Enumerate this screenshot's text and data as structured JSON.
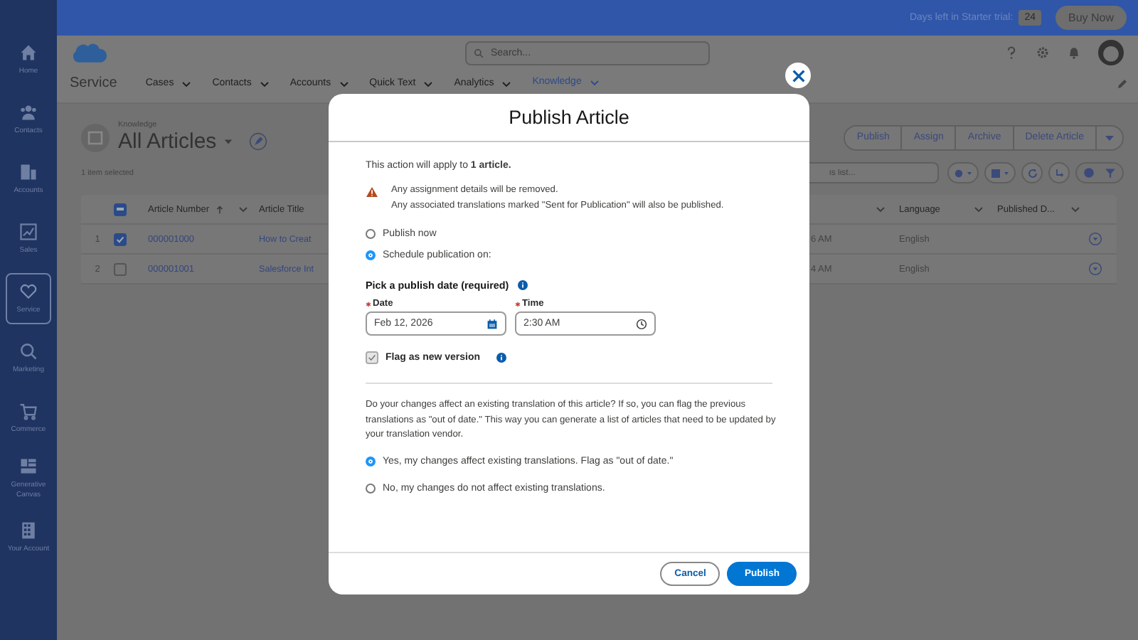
{
  "sidebar": {
    "items": [
      {
        "label": "Home",
        "selected": false
      },
      {
        "label": "Contacts",
        "selected": false
      },
      {
        "label": "Accounts",
        "selected": false
      },
      {
        "label": "Sales",
        "selected": false
      },
      {
        "label": "Service",
        "selected": true
      },
      {
        "label": "Marketing",
        "selected": false
      },
      {
        "label": "Commerce",
        "selected": false
      },
      {
        "label": "Generative Canvas",
        "selected": false
      },
      {
        "label": "Your Account",
        "selected": false
      }
    ]
  },
  "top_bar": {
    "trial_label": "Days left in Starter trial:",
    "trial_days": "24",
    "buy_button": "Buy Now"
  },
  "header": {
    "search": {
      "placeholder": "Search..."
    }
  },
  "app_nav": {
    "app_name": "Service",
    "tabs": [
      {
        "label": "Cases",
        "selected": false
      },
      {
        "label": "Contacts",
        "selected": false
      },
      {
        "label": "Accounts",
        "selected": false
      },
      {
        "label": "Quick Text",
        "selected": false
      },
      {
        "label": "Analytics",
        "selected": false
      },
      {
        "label": "Knowledge",
        "selected": true
      }
    ]
  },
  "list_view": {
    "breadcrumb": "Knowledge",
    "title": "All Articles",
    "selection_note": "1 item selected",
    "actions": [
      "Publish",
      "Assign",
      "Archive",
      "Delete Article"
    ],
    "search": {
      "placeholder": "is list..."
    },
    "table": {
      "select_all_partial": true,
      "columns": [
        {
          "label": "Article Number",
          "sorted": true
        },
        {
          "label": "Article Title",
          "sorted": false
        },
        {
          "sorted": false
        },
        {
          "label": "Language",
          "sorted": false
        },
        {
          "label": "Published D...",
          "sorted": false
        }
      ],
      "rows": [
        {
          "index": "1",
          "selected": true,
          "cells": [
            "000001000",
            "How to Creat",
            "6 AM",
            "English"
          ]
        },
        {
          "index": "2",
          "selected": false,
          "cells": [
            "000001001",
            "Salesforce Int",
            "4 AM",
            "English"
          ]
        }
      ]
    }
  },
  "dialog": {
    "title": "Publish Article",
    "scope_note": "This action will apply to **1 article.**",
    "warnings": [
      "Any assignment details will be removed.",
      "Any associated translations marked \"Sent for Publication\" will also be published."
    ],
    "timing_options": [
      {
        "label": "Publish now",
        "selected": false
      },
      {
        "label": "Schedule publication on:",
        "selected": true
      }
    ],
    "date_section": {
      "label": "Pick a publish date (required)",
      "date": {
        "label": "Date",
        "required": true,
        "value": "Feb 12, 2026"
      },
      "time": {
        "label": "Time",
        "required": true,
        "value": "2:30 AM"
      }
    },
    "flag_new_version": {
      "label": "Flag as new version",
      "checked": true,
      "disabled": true
    },
    "translation_note": "Do your changes affect an existing translation of this article? If so, you can flag the previous translations as \"out of date.\" This way you can generate a list of articles that need to be updated by your translation vendor.",
    "translation_options": [
      {
        "label": "Yes, my changes affect existing translations. Flag as \"out of date.\"",
        "selected": true
      },
      {
        "label": "No, my changes do not affect existing translations.",
        "selected": false
      }
    ],
    "buttons": {
      "cancel": "Cancel",
      "publish": "Publish"
    }
  }
}
